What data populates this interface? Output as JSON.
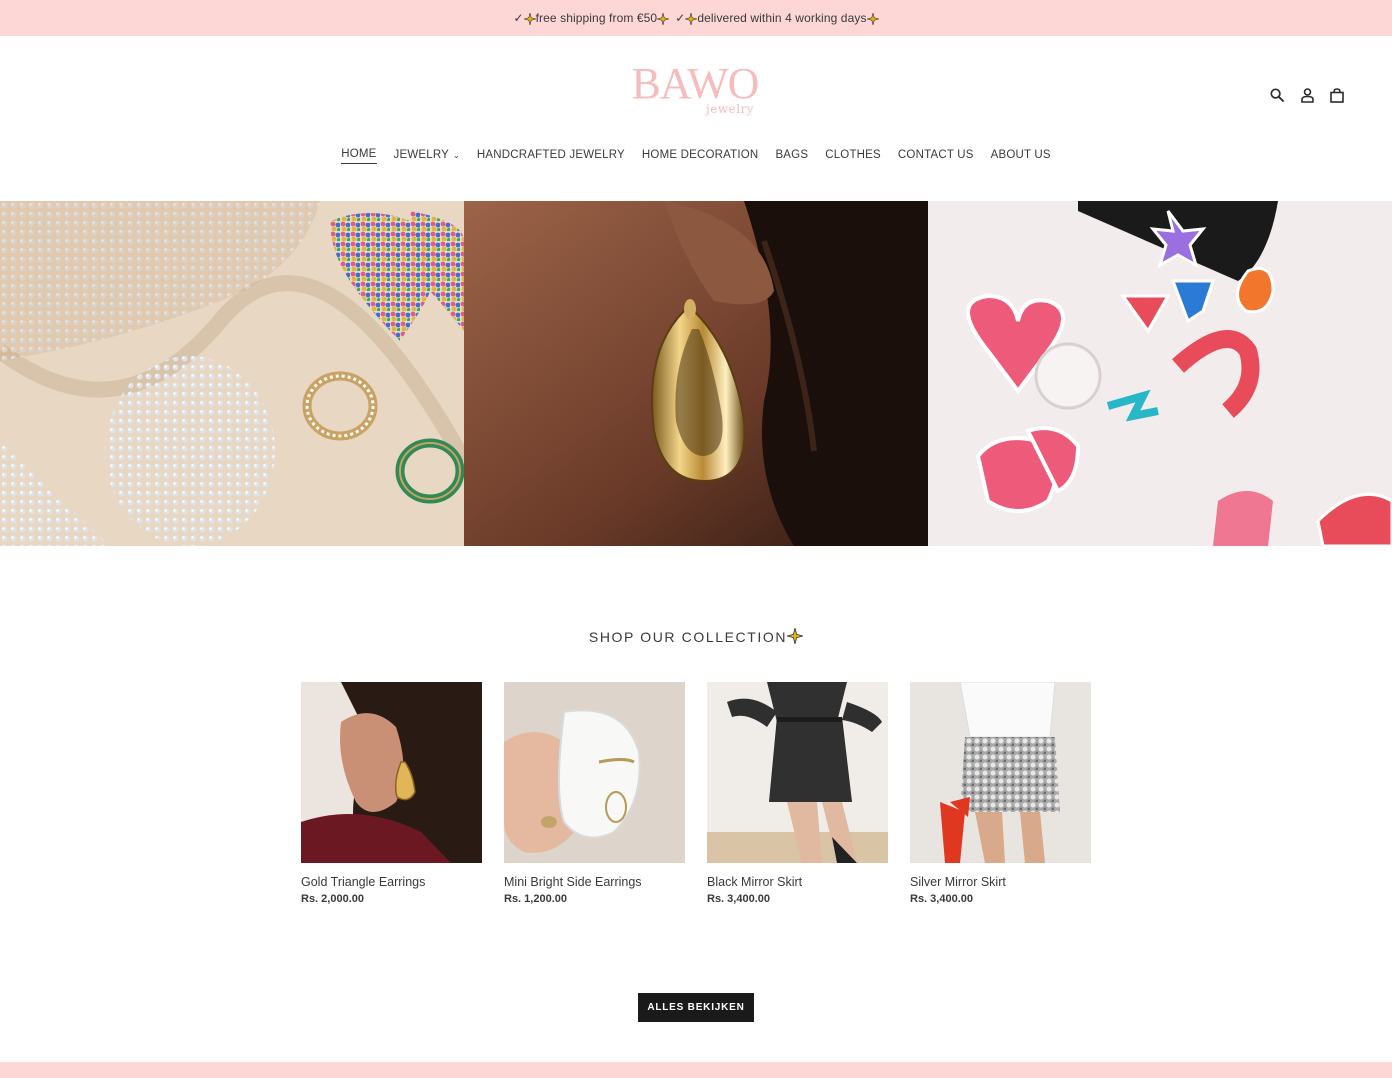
{
  "announcement": {
    "check1": "✓",
    "text1": "free shipping from €50",
    "check2": "✓",
    "text2": "delivered within 4 working days"
  },
  "brand": {
    "logo_main": "BAWO",
    "logo_sub": "jewelry",
    "color": "#f6bcbb"
  },
  "header_icons": [
    "search-icon",
    "account-icon",
    "cart-icon"
  ],
  "nav": {
    "items": [
      {
        "label": "HOME",
        "active": true
      },
      {
        "label": "JEWELRY",
        "dropdown": true
      },
      {
        "label": "HANDCRAFTED JEWELRY"
      },
      {
        "label": "HOME DECORATION"
      },
      {
        "label": "BAGS"
      },
      {
        "label": "CLOTHES"
      },
      {
        "label": "CONTACT US"
      },
      {
        "label": "ABOUT US"
      }
    ]
  },
  "collection": {
    "title": "SHOP OUR COLLECTION",
    "products": [
      {
        "title": "Gold Triangle Earrings",
        "price": "Rs. 2,000.00"
      },
      {
        "title": "Mini Bright Side Earrings",
        "price": "Rs. 1,200.00"
      },
      {
        "title": "Black Mirror Skirt",
        "price": "Rs. 3,400.00"
      },
      {
        "title": "Silver Mirror Skirt",
        "price": "Rs. 3,400.00"
      }
    ],
    "view_all_label": "ALLES BEKIJKEN"
  },
  "colors": {
    "announcement_bg": "#fcd7d6",
    "button_bg": "#1a1a1a",
    "text": "#3a3a3a"
  }
}
